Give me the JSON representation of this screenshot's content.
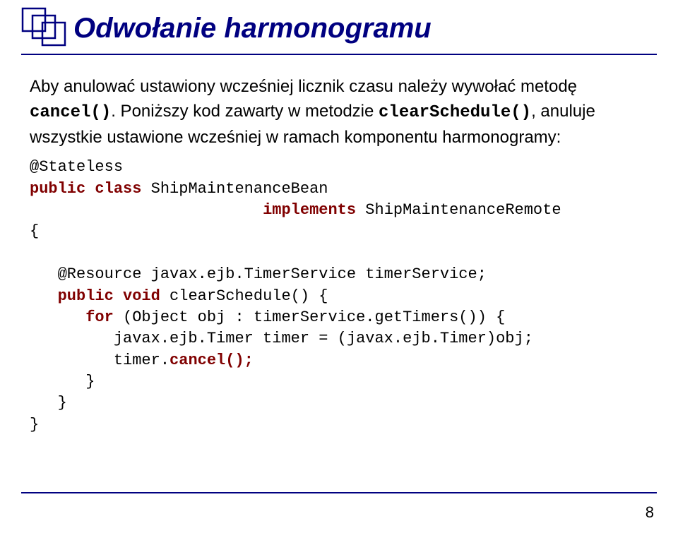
{
  "title": "Odwołanie harmonogramu",
  "para": {
    "pre": "Aby anulować ustawiony wcześniej licznik czasu należy wywołać metodę ",
    "code": "cancel()",
    "post": ". Poniższy kod zawarty w metodzie ",
    "code2": "clearSchedule()",
    "post2": ", anuluje wszystkie ustawione wcześniej w ramach komponentu harmonogramy:"
  },
  "code": {
    "l1a": "@Stateless",
    "l2a": "public",
    "l2b": " ",
    "l2c": "class",
    "l2d": " ShipMaintenanceBean",
    "l3a": "                         ",
    "l3b": "implements",
    "l3c": " ShipMaintenanceRemote",
    "l4": "{",
    "l5": "",
    "l6": "   @Resource javax.ejb.TimerService timerService;",
    "l7a": "   ",
    "l7b": "public",
    "l7c": " ",
    "l7d": "void",
    "l7e": " clearSchedule() {",
    "l8a": "      ",
    "l8b": "for",
    "l8c": " (Object obj : timerService.getTimers()) {",
    "l9": "         javax.ejb.Timer timer = (javax.ejb.Timer)obj;",
    "l10a": "         timer.",
    "l10b": "cancel();",
    "l11": "      }",
    "l12": "   }",
    "l13": "}"
  },
  "page_number": "8"
}
